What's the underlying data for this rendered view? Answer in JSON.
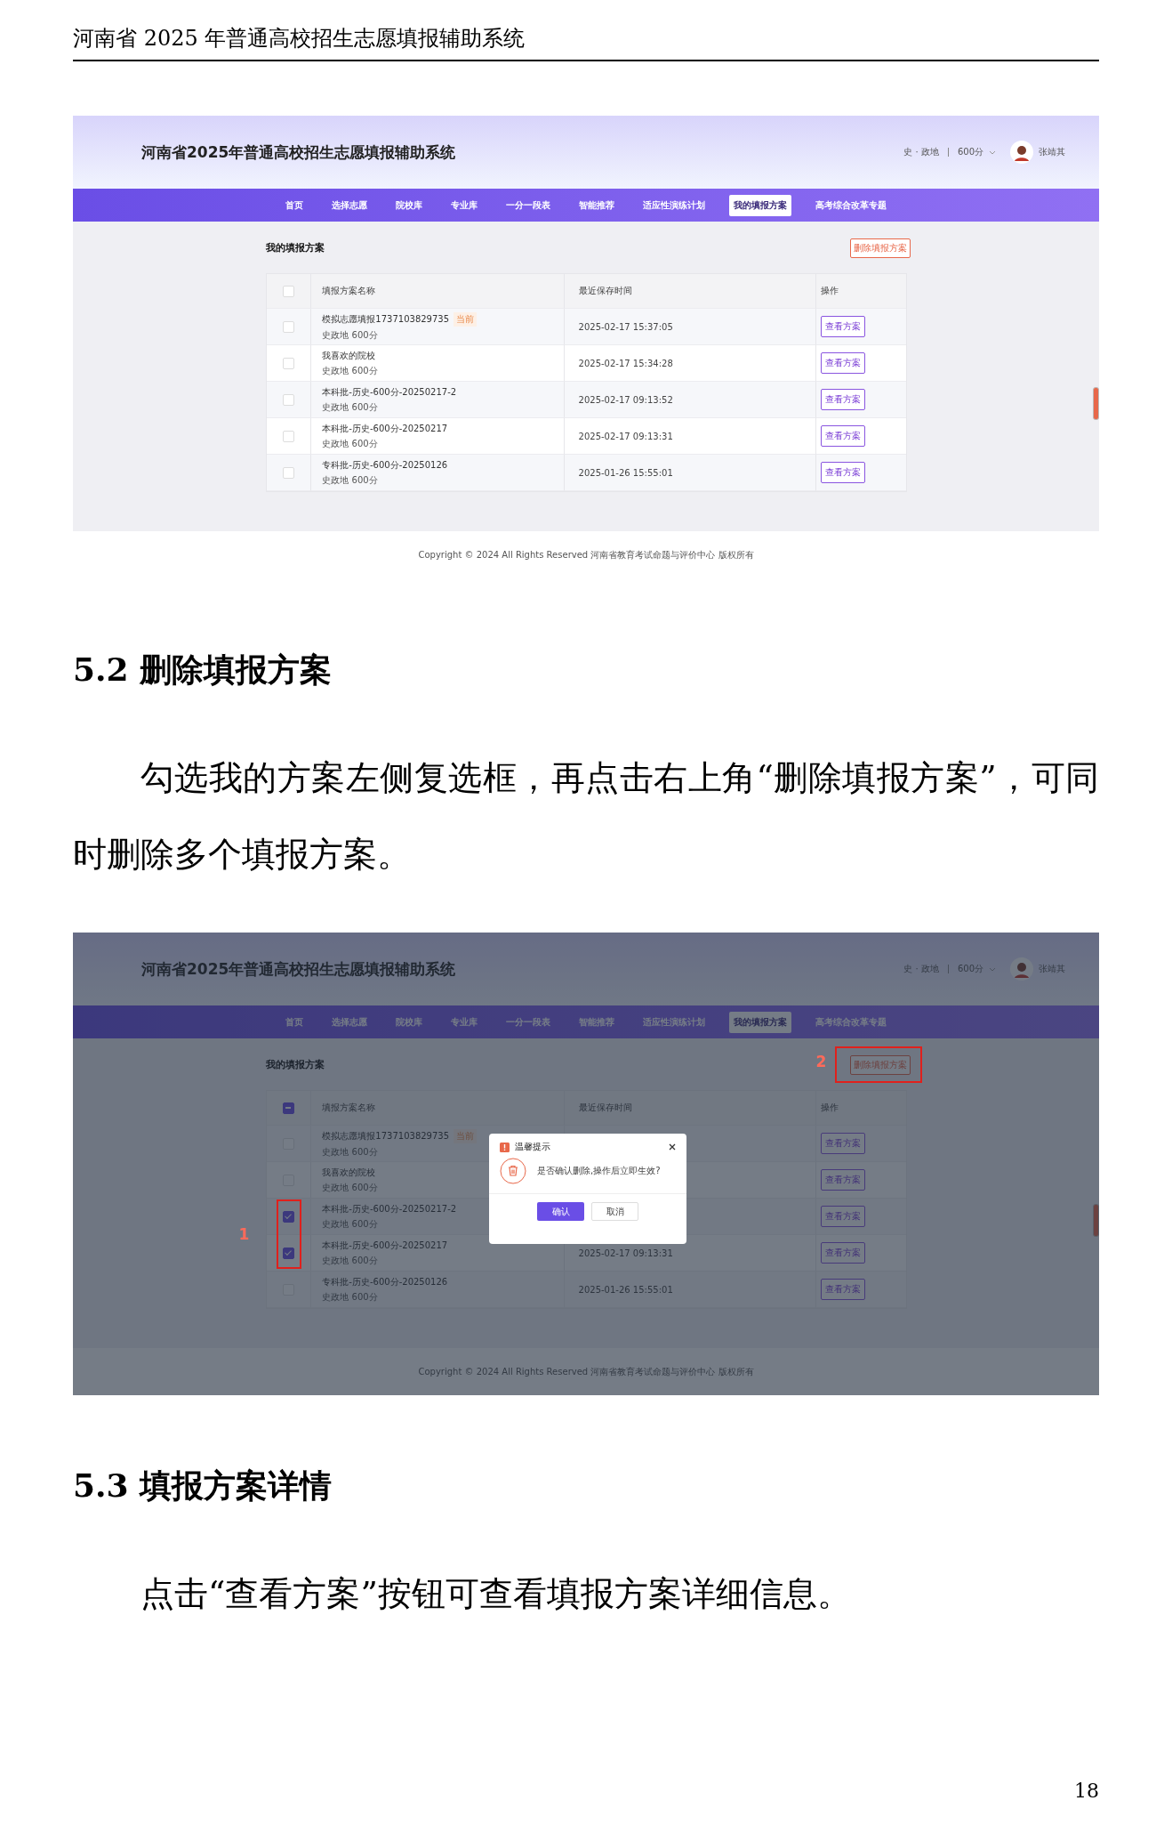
{
  "document_header": "河南省 2025 年普通高校招生志愿填报辅助系统",
  "screenshot_1": {
    "app_title": "河南省2025年普通高校招生志愿填报辅助系统",
    "subjects": "史 · 政地",
    "score": "600分",
    "user_name": "张靖其",
    "nav": [
      {
        "label": "首页",
        "selected": false
      },
      {
        "label": "选择志愿",
        "selected": false
      },
      {
        "label": "院校库",
        "selected": false
      },
      {
        "label": "专业库",
        "selected": false
      },
      {
        "label": "一分一段表",
        "selected": false
      },
      {
        "label": "智能推荐",
        "selected": false
      },
      {
        "label": "适应性演练计划",
        "selected": false
      },
      {
        "label": "我的填报方案",
        "selected": true
      },
      {
        "label": "高考综合改革专题",
        "selected": false
      }
    ],
    "panel_title": "我的填报方案",
    "delete_button": "删除填报方案",
    "select_all": {
      "partial": false
    },
    "columns": [
      "填报方案名称",
      "最近保存时间",
      "操作"
    ],
    "rows": [
      {
        "name": "模拟志愿填报1737103829735",
        "tag": "当前",
        "subtitle": "史政地 600分",
        "saved_time": "2025-02-17 15:37:05",
        "action": "查看方案",
        "checked": false
      },
      {
        "name": "我喜欢的院校",
        "subtitle": "史政地 600分",
        "saved_time": "2025-02-17 15:34:28",
        "action": "查看方案",
        "checked": false
      },
      {
        "name": "本科批-历史-600分-20250217-2",
        "subtitle": "史政地 600分",
        "saved_time": "2025-02-17 09:13:52",
        "action": "查看方案",
        "checked": false
      },
      {
        "name": "本科批-历史-600分-20250217",
        "subtitle": "史政地 600分",
        "saved_time": "2025-02-17 09:13:31",
        "action": "查看方案",
        "checked": false
      },
      {
        "name": "专科批-历史-600分-20250126",
        "subtitle": "史政地 600分",
        "saved_time": "2025-01-26 15:55:01",
        "action": "查看方案",
        "checked": false
      }
    ],
    "footer": "Copyright © 2024 All Rights Reserved  河南省教育考试命题与评价中心 版权所有"
  },
  "section_5_2": {
    "heading": "5.2 删除填报方案",
    "paragraph": "勾选我的方案左侧复选框，再点击右上角“删除填报方案”，可同时删除多个填报方案。"
  },
  "screenshot_2": {
    "app_title": "河南省2025年普通高校招生志愿填报辅助系统",
    "subjects": "史 · 政地",
    "score": "600分",
    "user_name": "张靖其",
    "nav": [
      {
        "label": "首页",
        "selected": false
      },
      {
        "label": "选择志愿",
        "selected": false
      },
      {
        "label": "院校库",
        "selected": false
      },
      {
        "label": "专业库",
        "selected": false
      },
      {
        "label": "一分一段表",
        "selected": false
      },
      {
        "label": "智能推荐",
        "selected": false
      },
      {
        "label": "适应性演练计划",
        "selected": false
      },
      {
        "label": "我的填报方案",
        "selected": true
      },
      {
        "label": "高考综合改革专题",
        "selected": false
      }
    ],
    "panel_title": "我的填报方案",
    "delete_button": "删除填报方案",
    "select_all": {
      "partial": true
    },
    "columns": [
      "填报方案名称",
      "最近保存时间",
      "操作"
    ],
    "rows": [
      {
        "name": "模拟志愿填报1737103829735",
        "tag": "当前",
        "subtitle": "史政地 600分",
        "action": "查看方案",
        "checked": false
      },
      {
        "name": "我喜欢的院校",
        "subtitle": "史政地 600分",
        "action": "查看方案",
        "checked": false
      },
      {
        "name": "本科批-历史-600分-20250217-2",
        "subtitle": "史政地 600分",
        "action": "查看方案",
        "checked": true
      },
      {
        "name": "本科批-历史-600分-20250217",
        "subtitle": "史政地 600分",
        "saved_time": "2025-02-17 09:13:31",
        "action": "查看方案",
        "checked": true
      },
      {
        "name": "专科批-历史-600分-20250126",
        "subtitle": "史政地 600分",
        "saved_time": "2025-01-26 15:55:01",
        "action": "查看方案",
        "checked": false
      }
    ],
    "footer": "Copyright © 2024 All Rights Reserved  河南省教育考试命题与评价中心 版权所有",
    "dialog": {
      "title": "温馨提示",
      "message": "是否确认删除,操作后立即生效?",
      "confirm": "确认",
      "cancel": "取消"
    },
    "annotations": [
      {
        "label": "1",
        "kind": "rows"
      },
      {
        "label": "2",
        "kind": "button"
      }
    ]
  },
  "section_5_3": {
    "heading": "5.3 填报方案详情",
    "paragraph": "点击“查看方案”按钮可查看填报方案详细信息。"
  },
  "page_number": "18"
}
